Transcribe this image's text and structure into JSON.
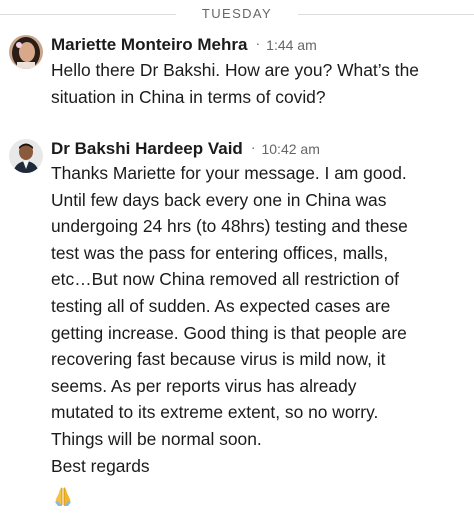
{
  "day_separator": "TUESDAY",
  "messages": [
    {
      "sender": "Mariette Monteiro Mehra",
      "time": "1:44 am",
      "lines": [
        "Hello there Dr Bakshi. How are you?  What’s the",
        "situation in China in terms of covid?"
      ]
    },
    {
      "sender": "Dr Bakshi Hardeep Vaid",
      "time": "10:42 am",
      "lines": [
        "Thanks Mariette for your message. I am good.",
        "Until few days back every one in China was",
        "undergoing 24 hrs (to 48hrs) testing and these",
        "test was the pass for entering offices, malls,",
        "etc…But now China removed all restriction of",
        "testing all of sudden. As expected cases are",
        "getting increase. Good thing is that people are",
        "recovering fast because virus is mild now, it",
        "seems.  As per reports virus has already",
        "mutated to its extreme extent, so no worry.",
        "Things will be normal soon.",
        "Best regards"
      ],
      "reaction_icon": "folded-hands-emoji"
    }
  ],
  "separator_dot": "·"
}
